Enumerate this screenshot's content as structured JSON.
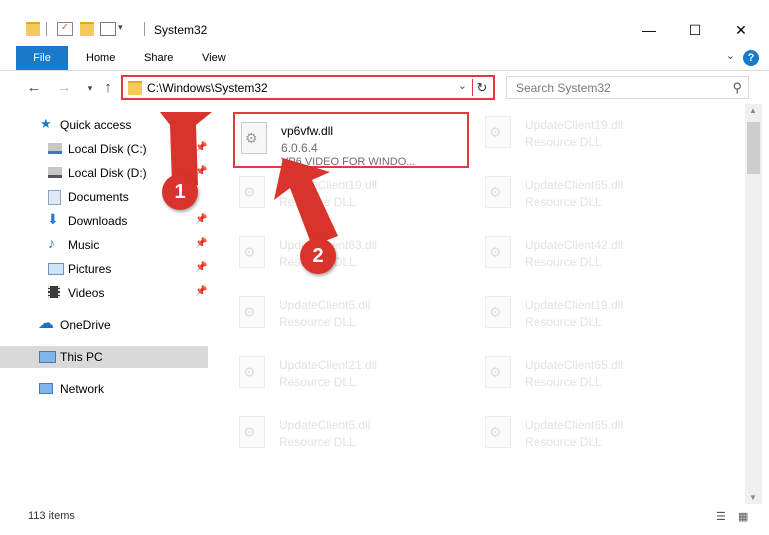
{
  "window": {
    "title": "System32",
    "minimize": "—",
    "maximize": "☐",
    "close": "✕"
  },
  "ribbon": {
    "tabs": [
      "File",
      "Home",
      "Share",
      "View"
    ],
    "help": "?"
  },
  "address": {
    "path": "C:\\Windows\\System32",
    "search_placeholder": "Search System32"
  },
  "nav": {
    "items": [
      {
        "label": "Quick access"
      },
      {
        "label": "Local Disk (C:)"
      },
      {
        "label": "Local Disk (D:)"
      },
      {
        "label": "Documents"
      },
      {
        "label": "Downloads"
      },
      {
        "label": "Music"
      },
      {
        "label": "Pictures"
      },
      {
        "label": "Videos"
      },
      {
        "label": "OneDrive"
      },
      {
        "label": "This PC"
      },
      {
        "label": "Network"
      }
    ]
  },
  "files": {
    "highlighted": {
      "name": "vp6vfw.dll",
      "version": "6.0.6.4",
      "description": "VP6 VIDEO FOR WINDO..."
    },
    "faded": [
      {
        "name": "UpdateClient19.dll",
        "type": "Resource DLL"
      },
      {
        "name": "UpdateClient19.dll",
        "type": "Resource DLL"
      },
      {
        "name": "UpdateClient65.dll",
        "type": "Resource DLL"
      },
      {
        "name": "UpdateClient63.dll",
        "type": "Resource DLL"
      },
      {
        "name": "UpdateClient42.dll",
        "type": "Resource DLL"
      },
      {
        "name": "UpdateClient5.dll",
        "type": "Resource DLL"
      },
      {
        "name": "UpdateClient19.dll",
        "type": "Resource DLL"
      },
      {
        "name": "UpdateClient21.dll",
        "type": "Resource DLL"
      },
      {
        "name": "UpdateClient65.dll",
        "type": "Resource DLL"
      },
      {
        "name": "UpdateClient5.dll",
        "type": "Resource DLL"
      },
      {
        "name": "UpdateClient65.dll",
        "type": "Resource DLL"
      }
    ]
  },
  "status": {
    "count": "113 items"
  },
  "callouts": [
    "1",
    "2"
  ]
}
